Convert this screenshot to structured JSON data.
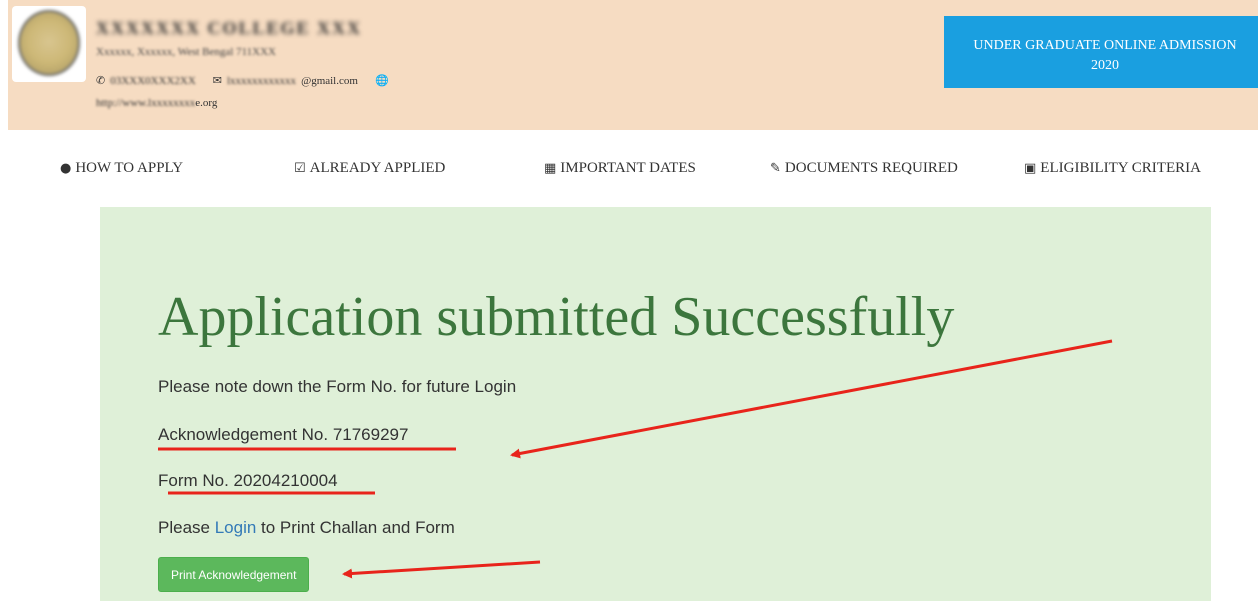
{
  "header": {
    "college_name": "XXXXXXX COLLEGE XXX",
    "address": "Xxxxxx, Xxxxxx, West Bengal 711XXX",
    "phone": "03XXX0XXX2XX",
    "email_prefix": "lxxxxxxxxxxxx",
    "email_suffix": "@gmail.com",
    "website_prefix": "http://www.lxxxxxxxx",
    "website_suffix": "e.org",
    "admission_line1": "UNDER GRADUATE ONLINE ADMISSION",
    "admission_line2": "2020"
  },
  "nav": {
    "how_to_apply": "HOW TO APPLY",
    "already_applied": "ALREADY APPLIED",
    "important_dates": "IMPORTANT DATES",
    "documents_required": "DOCUMENTS REQUIRED",
    "eligibility_criteria": "ELIGIBILITY CRITERIA"
  },
  "main": {
    "title": "Application submitted Successfully",
    "note": "Please note down the Form No. for future Login",
    "ack_label": "Acknowledgement No. 71769297",
    "form_label": "Form No. 20204210004",
    "login_prefix": "Please ",
    "login_link": "Login",
    "login_suffix": " to Print Challan and Form",
    "print_button": "Print Acknowledgement"
  },
  "colors": {
    "header_bg": "#f6dcc2",
    "accent_blue": "#1a9fe0",
    "panel_bg": "#dff0d8",
    "title_green": "#3c763d",
    "button_green": "#5cb85c",
    "annotation_red": "#e8241b"
  },
  "icons": {
    "how_to_apply": "info-circle-icon",
    "already_applied": "check-square-icon",
    "important_dates": "calendar-icon",
    "documents_required": "edit-icon",
    "eligibility_criteria": "criteria-icon"
  }
}
